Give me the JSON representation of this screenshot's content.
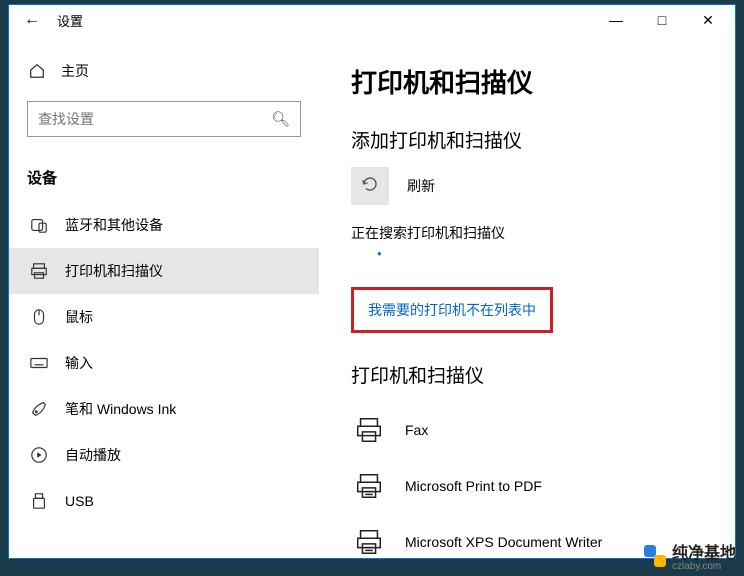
{
  "titlebar": {
    "title": "设置"
  },
  "sidebar": {
    "home_label": "主页",
    "search_placeholder": "查找设置",
    "section_heading": "设备",
    "items": [
      {
        "label": "蓝牙和其他设备",
        "icon": "bluetooth"
      },
      {
        "label": "打印机和扫描仪",
        "icon": "printer",
        "selected": true
      },
      {
        "label": "鼠标",
        "icon": "mouse"
      },
      {
        "label": "输入",
        "icon": "keyboard"
      },
      {
        "label": "笔和 Windows Ink",
        "icon": "pen"
      },
      {
        "label": "自动播放",
        "icon": "autoplay"
      },
      {
        "label": "USB",
        "icon": "usb"
      }
    ]
  },
  "content": {
    "page_title": "打印机和扫描仪",
    "add_section_title": "添加打印机和扫描仪",
    "refresh_label": "刷新",
    "searching_text": "正在搜索打印机和扫描仪",
    "missing_printer_link": "我需要的打印机不在列表中",
    "list_section_title": "打印机和扫描仪",
    "printers": [
      {
        "name": "Fax"
      },
      {
        "name": "Microsoft Print to PDF"
      },
      {
        "name": "Microsoft XPS Document Writer"
      }
    ]
  },
  "watermark": {
    "text": "纯净基地",
    "url": "czlaby.com"
  }
}
